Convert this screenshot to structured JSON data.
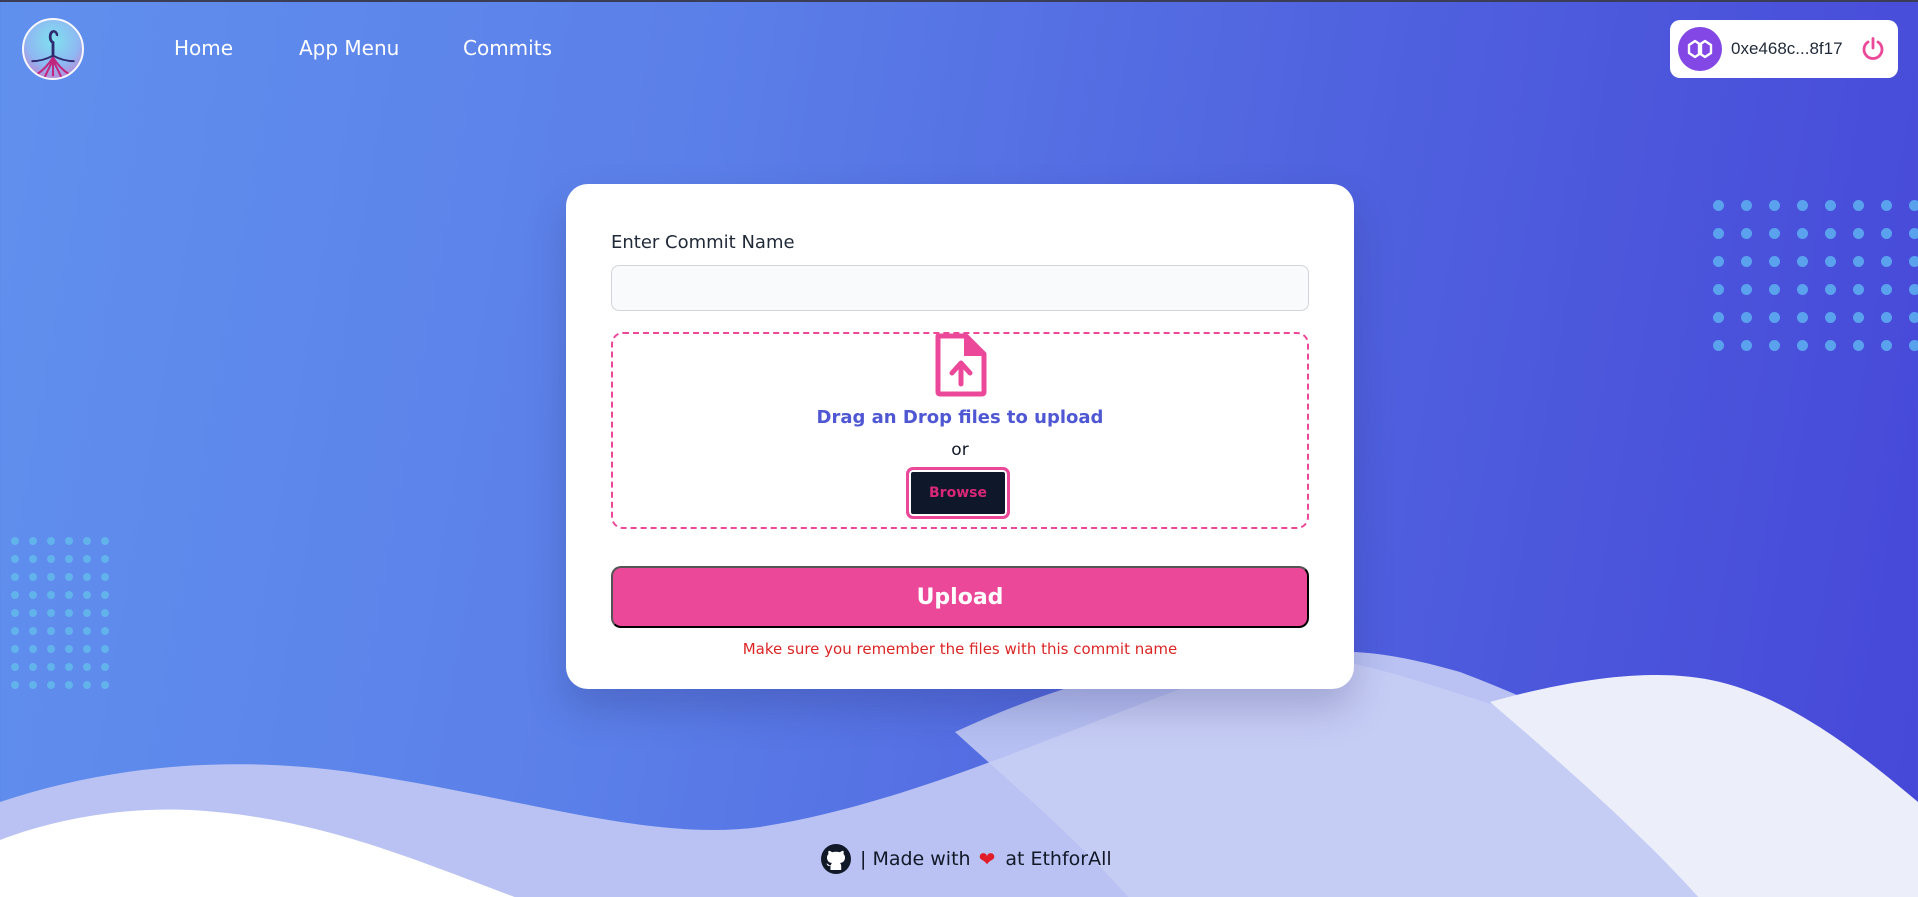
{
  "nav": {
    "links": [
      {
        "label": "Home"
      },
      {
        "label": "App Menu"
      },
      {
        "label": "Commits"
      }
    ]
  },
  "wallet": {
    "address": "0xe468c...8f17",
    "network_icon": "polygon-icon",
    "power_icon": "power-icon"
  },
  "form": {
    "commit_label": "Enter Commit Name",
    "commit_value": "",
    "commit_placeholder": "",
    "dropzone": {
      "icon": "file-upload-icon",
      "title": "Drag an Drop files to upload",
      "or": "or",
      "browse_label": "Browse"
    },
    "upload_label": "Upload",
    "note": "Make sure you remember the files with this commit name"
  },
  "footer": {
    "github_icon": "github-icon",
    "made_with": "| Made with",
    "heart": "❤",
    "at": "at EthforAll"
  },
  "colors": {
    "accent_pink": "#ec4899",
    "link_blue": "#4f57d3",
    "warning_red": "#dc2626",
    "polygon_purple": "#8247e5"
  }
}
